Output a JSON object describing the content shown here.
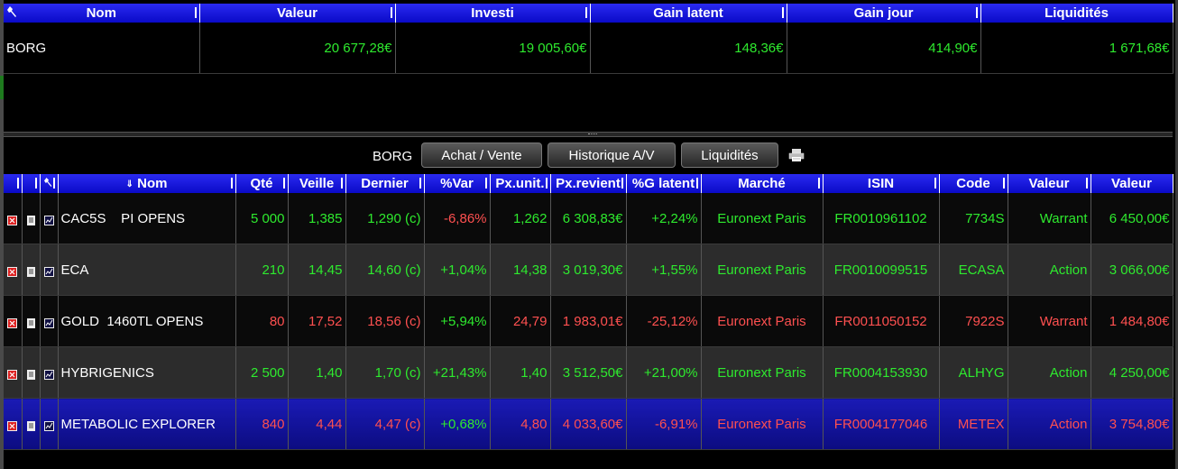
{
  "summary": {
    "columns": [
      "Nom",
      "Valeur",
      "Investi",
      "Gain latent",
      "Gain jour",
      "Liquidités"
    ],
    "row": {
      "nom": "BORG",
      "valeur": "20 677,28€",
      "investi": "19 005,60€",
      "gain_latent": "148,36€",
      "gain_jour": "414,90€",
      "liquidites": "1 671,68€"
    }
  },
  "toolbar": {
    "account": "BORG",
    "buy_sell_label": "Achat / Vente",
    "history_label": "Historique A/V",
    "cash_label": "Liquidités",
    "print_icon": "printer-icon"
  },
  "positions": {
    "columns": [
      "Nom",
      "Qté",
      "Veille",
      "Dernier",
      "%Var",
      "Px.unit.",
      "Px.revient",
      "%G latent",
      "Marché",
      "ISIN",
      "Code",
      "Valeur",
      "Valeur"
    ],
    "rows": [
      {
        "nom": "CAC5S    PI OPENS",
        "qte": "5 000",
        "veille": "1,385",
        "dernier": "1,290 (c)",
        "var": "-6,86%",
        "pxunit": "1,262",
        "pxrevient": "6 308,83€",
        "glatent": "+2,24%",
        "marche": "Euronext Paris",
        "isin": "FR0010961102",
        "code": "7734S",
        "type": "Warrant",
        "valeur": "6 450,00€"
      },
      {
        "nom": "ECA",
        "qte": "210",
        "veille": "14,45",
        "dernier": "14,60 (c)",
        "var": "+1,04%",
        "pxunit": "14,38",
        "pxrevient": "3 019,30€",
        "glatent": "+1,55%",
        "marche": "Euronext Paris",
        "isin": "FR0010099515",
        "code": "ECASA",
        "type": "Action",
        "valeur": "3 066,00€"
      },
      {
        "nom": "GOLD  1460TL OPENS",
        "qte": "80",
        "veille": "17,52",
        "dernier": "18,56 (c)",
        "var": "+5,94%",
        "pxunit": "24,79",
        "pxrevient": "1 983,01€",
        "glatent": "-25,12%",
        "marche": "Euronext Paris",
        "isin": "FR0011050152",
        "code": "7922S",
        "type": "Warrant",
        "valeur": "1 484,80€"
      },
      {
        "nom": "HYBRIGENICS",
        "qte": "2 500",
        "veille": "1,40",
        "dernier": "1,70 (c)",
        "var": "+21,43%",
        "pxunit": "1,40",
        "pxrevient": "3 512,50€",
        "glatent": "+21,00%",
        "marche": "Euronext Paris",
        "isin": "FR0004153930",
        "code": "ALHYG",
        "type": "Action",
        "valeur": "4 250,00€"
      },
      {
        "nom": "METABOLIC EXPLORER",
        "qte": "840",
        "veille": "4,44",
        "dernier": "4,47 (c)",
        "var": "+0,68%",
        "pxunit": "4,80",
        "pxrevient": "4 033,60€",
        "glatent": "-6,91%",
        "marche": "Euronext Paris",
        "isin": "FR0004177046",
        "code": "METEX",
        "type": "Action",
        "valeur": "3 754,80€"
      }
    ]
  },
  "colors": {
    "positive": "#2eea2e",
    "negative": "#ff5050",
    "header": "#0a0ac8",
    "selected": "#1a1ab5"
  }
}
